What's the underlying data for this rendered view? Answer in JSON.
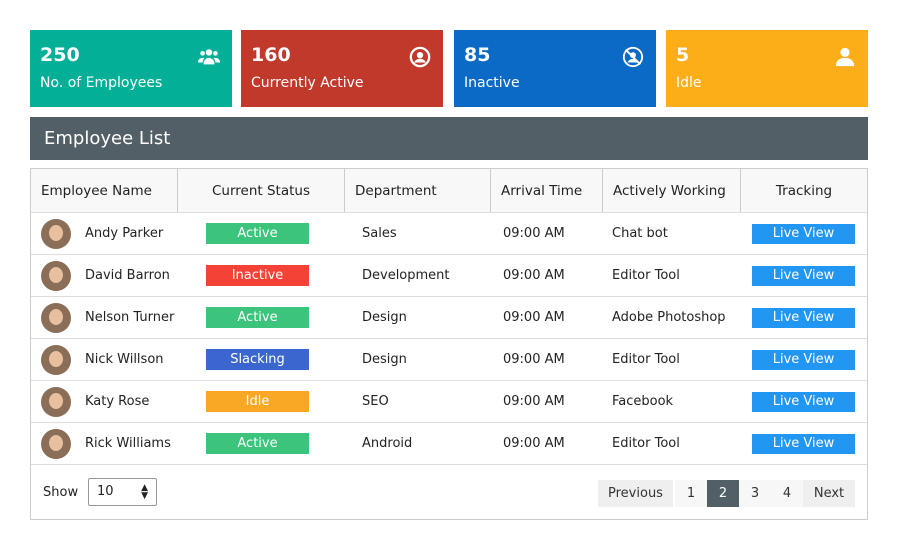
{
  "cards": [
    {
      "value": "250",
      "label": "No. of Employees",
      "icon": "users-icon",
      "color": "#03b097"
    },
    {
      "value": "160",
      "label": "Currently Active",
      "icon": "user-circle-icon",
      "color": "#c0392b"
    },
    {
      "value": "85",
      "label": "Inactive",
      "icon": "user-slash-icon",
      "color": "#0b6ac6"
    },
    {
      "value": "5",
      "label": "Idle",
      "icon": "user-icon",
      "color": "#fbae17"
    }
  ],
  "title": "Employee List",
  "columns": [
    "Employee Name",
    "Current Status",
    "Department",
    "Arrival Time",
    "Actively Working",
    "Tracking"
  ],
  "rows": [
    {
      "name": "Andy Parker",
      "status": "Active",
      "dept": "Sales",
      "time": "09:00 AM",
      "working": "Chat bot",
      "tracking": "Live View"
    },
    {
      "name": "David Barron",
      "status": "Inactive",
      "dept": "Development",
      "time": "09:00 AM",
      "working": "Editor Tool",
      "tracking": "Live View"
    },
    {
      "name": "Nelson Turner",
      "status": "Active",
      "dept": "Design",
      "time": "09:00 AM",
      "working": "Adobe Photoshop",
      "tracking": "Live View"
    },
    {
      "name": "Nick Willson",
      "status": "Slacking",
      "dept": "Design",
      "time": "09:00 AM",
      "working": "Editor Tool",
      "tracking": "Live View"
    },
    {
      "name": "Katy Rose",
      "status": "Idle",
      "dept": "SEO",
      "time": "09:00 AM",
      "working": "Facebook",
      "tracking": "Live View"
    },
    {
      "name": "Rick Williams",
      "status": "Active",
      "dept": "Android",
      "time": "09:00 AM",
      "working": "Editor Tool",
      "tracking": "Live View"
    }
  ],
  "status_colors": {
    "Active": "#3cc47c",
    "Inactive": "#f44336",
    "Slacking": "#3b66d0",
    "Idle": "#f9a825"
  },
  "footer": {
    "show_label": "Show",
    "page_size": "10",
    "previous": "Previous",
    "pages": [
      "1",
      "2",
      "3",
      "4"
    ],
    "current_page": "2",
    "next": "Next"
  }
}
